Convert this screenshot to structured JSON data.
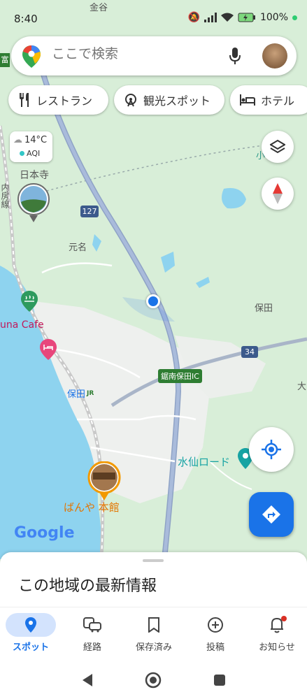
{
  "status": {
    "time": "8:40",
    "battery": "100%"
  },
  "search": {
    "placeholder": "ここで検索"
  },
  "chips": [
    {
      "label": "レストラン"
    },
    {
      "label": "観光スポット"
    },
    {
      "label": "ホテル"
    }
  ],
  "weather": {
    "temp": "14°C",
    "aqi": "AQI"
  },
  "map_labels": {
    "top": "金谷",
    "nihonji": "日本寺",
    "line": "内房線",
    "motona": "元名",
    "hota": "保田",
    "hota_station": "保田",
    "jr": "JR",
    "cafe": "una Cafe",
    "ic": "鋸南保田IC",
    "suisen": "水仙ロード",
    "banya": "ばんや 本館",
    "route127": "127",
    "route34": "34",
    "edge_top": "富",
    "edge_right1": "小",
    "edge_right2": "大",
    "google": "Google"
  },
  "sheet": {
    "title": "この地域の最新情報"
  },
  "nav": [
    {
      "label": "スポット",
      "active": true
    },
    {
      "label": "経路"
    },
    {
      "label": "保存済み"
    },
    {
      "label": "投稿"
    },
    {
      "label": "お知らせ"
    }
  ],
  "colors": {
    "accent": "#1a73e8",
    "water": "#8ed3ef",
    "land": "#dcefdc",
    "road": "#9aaac8"
  }
}
